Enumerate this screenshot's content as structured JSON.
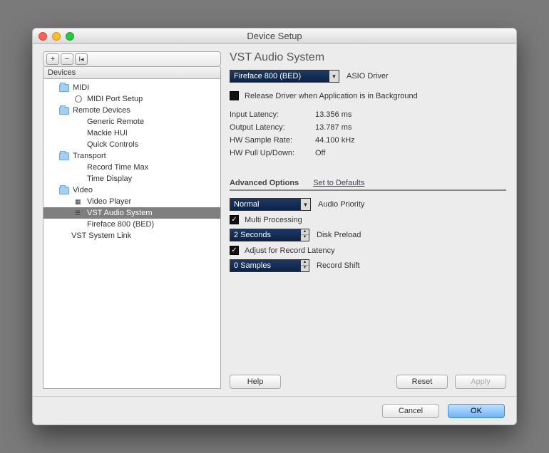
{
  "window": {
    "title": "Device Setup"
  },
  "sidebar": {
    "header": "Devices",
    "items": [
      {
        "label": "MIDI",
        "type": "folder",
        "indent": 1
      },
      {
        "label": "MIDI Port Setup",
        "type": "ring",
        "indent": 2
      },
      {
        "label": "Remote Devices",
        "type": "folder",
        "indent": 1
      },
      {
        "label": "Generic Remote",
        "type": "none",
        "indent": 2
      },
      {
        "label": "Mackie HUI",
        "type": "none",
        "indent": 2
      },
      {
        "label": "Quick Controls",
        "type": "none",
        "indent": 2
      },
      {
        "label": "Transport",
        "type": "folder",
        "indent": 1
      },
      {
        "label": "Record Time Max",
        "type": "none",
        "indent": 2
      },
      {
        "label": "Time Display",
        "type": "none",
        "indent": 2
      },
      {
        "label": "Video",
        "type": "folder",
        "indent": 1
      },
      {
        "label": "Video Player",
        "type": "video",
        "indent": 2
      },
      {
        "label": "VST Audio System",
        "type": "audio",
        "indent": 2,
        "selected": true
      },
      {
        "label": "Fireface 800 (BED)",
        "type": "none",
        "indent": 2
      },
      {
        "label": "VST System Link",
        "type": "none",
        "indent": 1
      }
    ]
  },
  "panel": {
    "title": "VST Audio System",
    "asio_driver": {
      "value": "Fireface 800 (BED)",
      "label": "ASIO Driver"
    },
    "release_driver": {
      "checked": false,
      "label": "Release Driver when Application is in Background"
    },
    "info": {
      "input_latency": {
        "k": "Input Latency:",
        "v": "13.356 ms"
      },
      "output_latency": {
        "k": "Output Latency:",
        "v": "13.787 ms"
      },
      "hw_sample_rate": {
        "k": "HW Sample Rate:",
        "v": "44.100 kHz"
      },
      "hw_pull": {
        "k": "HW Pull Up/Down:",
        "v": "Off"
      }
    },
    "advanced": {
      "header": "Advanced Options",
      "defaults_link": "Set to Defaults",
      "audio_priority": {
        "value": "Normal",
        "label": "Audio Priority"
      },
      "multi_processing": {
        "checked": true,
        "label": "Multi Processing"
      },
      "disk_preload": {
        "value": "2 Seconds",
        "label": "Disk Preload"
      },
      "adjust_record": {
        "checked": true,
        "label": "Adjust for Record Latency"
      },
      "record_shift": {
        "value": "0 Samples",
        "label": "Record Shift"
      }
    },
    "buttons": {
      "help": "Help",
      "reset": "Reset",
      "apply": "Apply"
    }
  },
  "footer": {
    "cancel": "Cancel",
    "ok": "OK"
  }
}
